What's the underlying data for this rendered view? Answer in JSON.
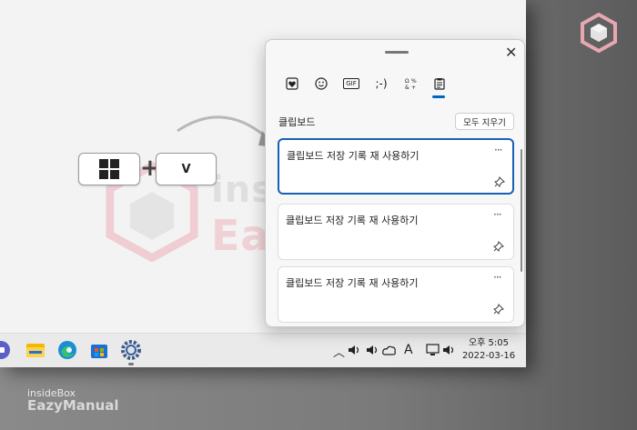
{
  "shortcut": {
    "plus": "+",
    "v_key": "V"
  },
  "watermark": {
    "line1": "insideBox",
    "line2": "EazyManual"
  },
  "clipboard": {
    "tabs": [
      "emoji-favorites-icon",
      "emoji-icon",
      "gif-icon",
      "kaomoji-icon",
      "symbols-icon",
      "clipboard-icon"
    ],
    "gif_label": "GIF",
    "kaomoji_label": ";-)",
    "section_title": "클립보드",
    "clear_all_label": "모두 지우기",
    "items": [
      {
        "text": "클립보드 저장 기록 재 사용하기",
        "selected": true
      },
      {
        "text": "클립보드 저장 기록 재 사용하기",
        "selected": false
      },
      {
        "text": "클립보드 저장 기록 재 사용하기",
        "selected": false
      }
    ],
    "more_label": "···"
  },
  "taskbar": {
    "ime_label": "A",
    "clock": {
      "ampm_time": "오후 5:05",
      "date": "2022-03-16"
    }
  },
  "brand": {
    "line1": "insideBox",
    "line2": "EazyManual"
  },
  "colors": {
    "accent": "#0067c0",
    "selected_border": "#1a5fb4"
  }
}
